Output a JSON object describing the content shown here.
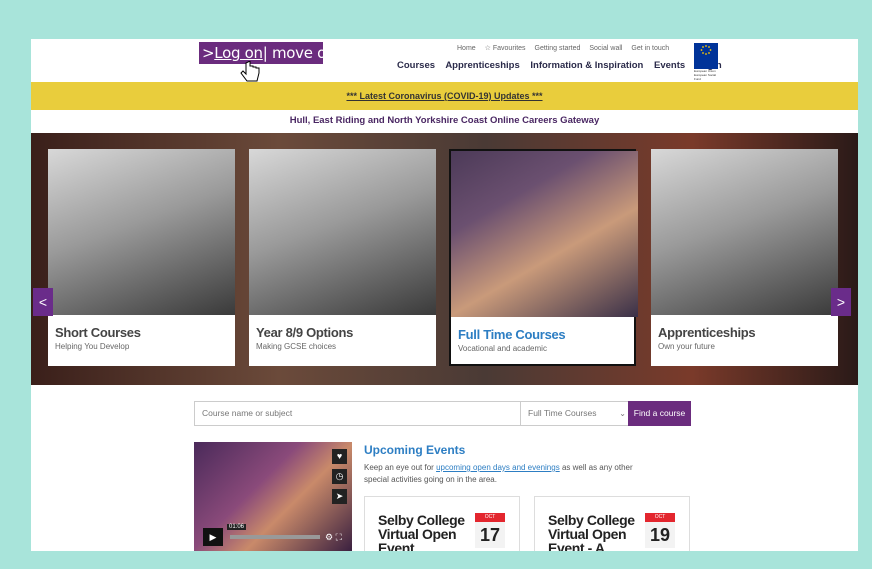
{
  "header": {
    "logo": {
      "part1": ">",
      "part2": "Log on",
      "part3": "| move on >"
    },
    "util_links": [
      "Home",
      "☆ Favourites",
      "Getting started",
      "Social wall",
      "Get in touch"
    ],
    "main_nav": [
      "Courses",
      "Apprenticeships",
      "Information & Inspiration",
      "Events",
      "Login"
    ],
    "eu_label": "European Union European Social Fund"
  },
  "banner": {
    "covid": "*** Latest Coronavirus (COVID-19) Updates ***"
  },
  "gateway_title": "Hull, East Riding and North Yorkshire Coast Online Careers Gateway",
  "carousel": {
    "prev": "<",
    "next": ">",
    "cards": [
      {
        "title": "Short Courses",
        "subtitle": "Helping You Develop"
      },
      {
        "title": "Year 8/9 Options",
        "subtitle": "Making GCSE choices"
      },
      {
        "title": "Full Time Courses",
        "subtitle": "Vocational and academic"
      },
      {
        "title": "Apprenticeships",
        "subtitle": "Own your future"
      }
    ]
  },
  "search": {
    "placeholder": "Course name or subject",
    "selected": "Full Time Courses",
    "button": "Find a course"
  },
  "video": {
    "time": "01:06"
  },
  "events": {
    "title": "Upcoming Events",
    "text_before": "Keep an eye out for ",
    "link": "upcoming open days and evenings",
    "text_after": " as well as any other special activities going on in the area.",
    "items": [
      {
        "title": "Selby College Virtual Open Event",
        "month": "OCT",
        "day": "17"
      },
      {
        "title": "Selby College Virtual Open Event - A Levels",
        "month": "OCT",
        "day": "19"
      }
    ]
  },
  "colors": {
    "brand_purple": "#6b2c7e",
    "banner_yellow": "#e9cd3c",
    "accent_blue": "#2d7ec3",
    "frame": "#a8e4da"
  }
}
